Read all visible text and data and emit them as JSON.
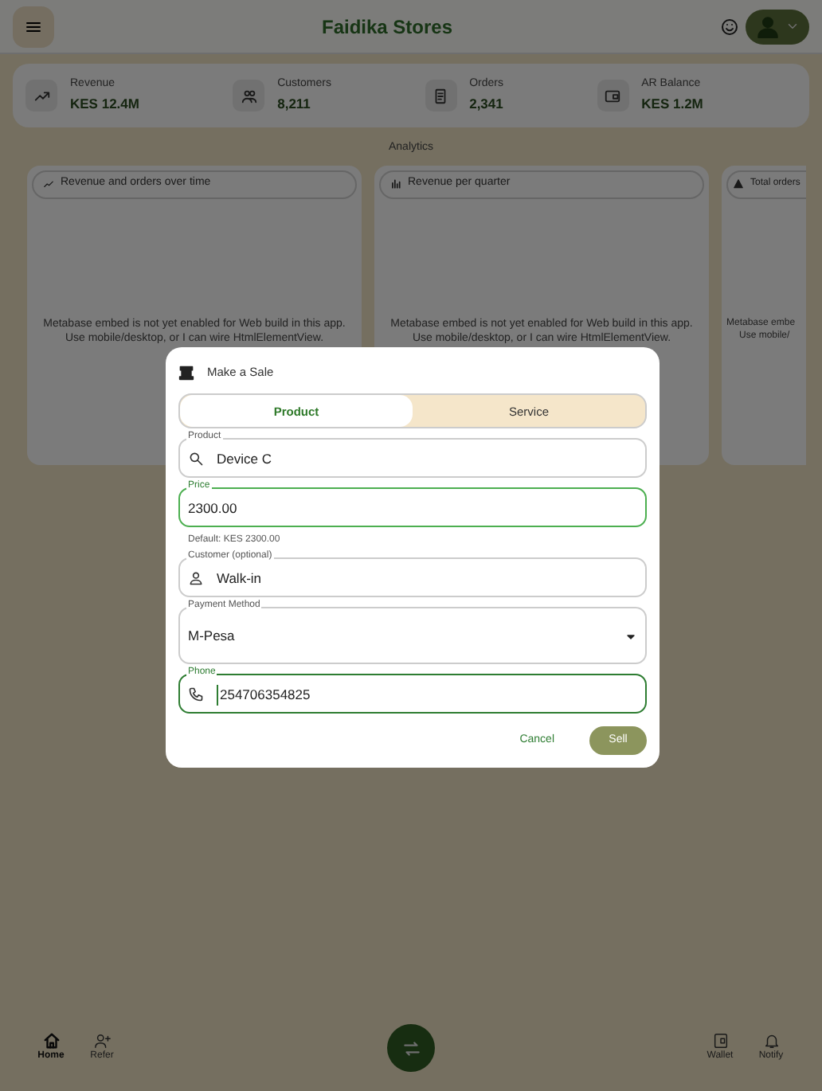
{
  "header": {
    "title": "Faidika Stores"
  },
  "stats": [
    {
      "kind": "trend",
      "label": "Revenue",
      "value": "KES 12.4M"
    },
    {
      "kind": "people",
      "label": "Customers",
      "value": "8,211"
    },
    {
      "kind": "receipt",
      "label": "Orders",
      "value": "2,341"
    },
    {
      "kind": "wallet",
      "label": "AR Balance",
      "value": "KES 1.2M"
    }
  ],
  "section_title": "Analytics",
  "analytics_cards": [
    {
      "kind": "line",
      "title": "Revenue and orders over time",
      "message": "Metabase embed is not yet enabled for Web build in this app. Use mobile/desktop, or I can wire HtmlElementView."
    },
    {
      "kind": "bar",
      "title": "Revenue per quarter",
      "message": "Metabase embed is not yet enabled for Web build in this app. Use mobile/desktop, or I can wire HtmlElementView."
    },
    {
      "kind": "pyramid",
      "title": "Total orders",
      "message_lines": [
        "Metabase embe",
        "Use mobile/"
      ]
    }
  ],
  "dialog": {
    "title": "Make a Sale",
    "tabs": [
      {
        "label": "Product",
        "selected": true
      },
      {
        "label": "Service",
        "selected": false
      }
    ],
    "fields": [
      {
        "kind": "search",
        "label": "Product",
        "value": "Device C",
        "focused": false
      },
      {
        "kind": "text",
        "label": "Price",
        "value": "2300.00",
        "focused": true,
        "helper": "Default: KES 2300.00"
      },
      {
        "kind": "person",
        "label": "Customer (optional)",
        "value": "Walk-in",
        "focused": false
      },
      {
        "kind": "select",
        "label": "Payment Method",
        "value": "M-Pesa",
        "focused": false
      },
      {
        "kind": "phone",
        "label": "Phone",
        "value": "254706354825",
        "focused": true
      }
    ],
    "buttons": [
      {
        "kind": "text",
        "label": "Cancel"
      },
      {
        "kind": "filled",
        "label": "Sell"
      }
    ]
  },
  "bottom_nav": [
    {
      "kind": "home",
      "label": "Home",
      "selected": true
    },
    {
      "kind": "refer",
      "label": "Refer",
      "selected": false
    },
    {
      "kind": "fab"
    },
    {
      "kind": "wallet",
      "label": "Wallet",
      "selected": false
    },
    {
      "kind": "bell",
      "label": "Notify",
      "selected": false
    }
  ]
}
